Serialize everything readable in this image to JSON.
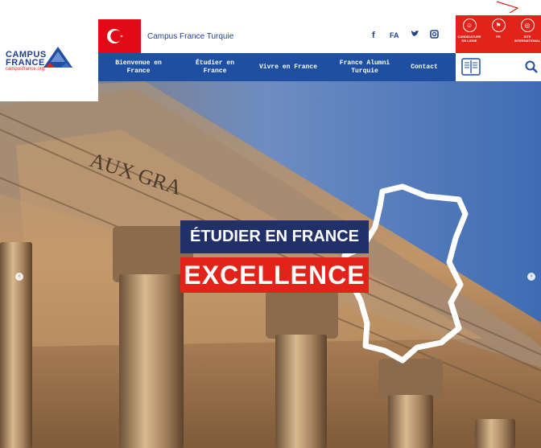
{
  "brand": {
    "logo_line1": "CAMPUS",
    "logo_line2": "FRANCE",
    "logo_url": "campusfrance.org"
  },
  "header": {
    "site_title": "Campus France Turquie",
    "social": {
      "facebook": "f",
      "language": "FA",
      "twitter": "❚",
      "instagram": "▣"
    },
    "actions": [
      {
        "label_line1": "CANDIDATURE",
        "label_line2": "EN LIGNE",
        "icon": "user-icon"
      },
      {
        "label_line1": "FR",
        "label_line2": "",
        "icon": "flag-icon"
      },
      {
        "label_line1": "SITE",
        "label_line2": "INTERNATIONAL",
        "icon": "globe-icon"
      }
    ]
  },
  "nav": {
    "items": [
      {
        "line1": "Bienvenue en",
        "line2": "France"
      },
      {
        "line1": "Étudier en",
        "line2": "France"
      },
      {
        "line1": "Vivre en France",
        "line2": ""
      },
      {
        "line1": "France Alumni",
        "line2": "Turquie"
      },
      {
        "line1": "Contact",
        "line2": ""
      }
    ],
    "tools": {
      "catalog_icon": "book-icon",
      "search_icon": "search-icon"
    }
  },
  "hero": {
    "headline": "ÉTUDIER EN FRANCE",
    "subheadline": "EXCELLENCE",
    "inscription": "AUX GRA",
    "prev_arrow": "‹",
    "next_arrow": "›"
  },
  "colors": {
    "brand_blue": "#1f4fa1",
    "brand_red": "#e2231a",
    "navy": "#22306a",
    "turkey_red": "#e30a17"
  }
}
